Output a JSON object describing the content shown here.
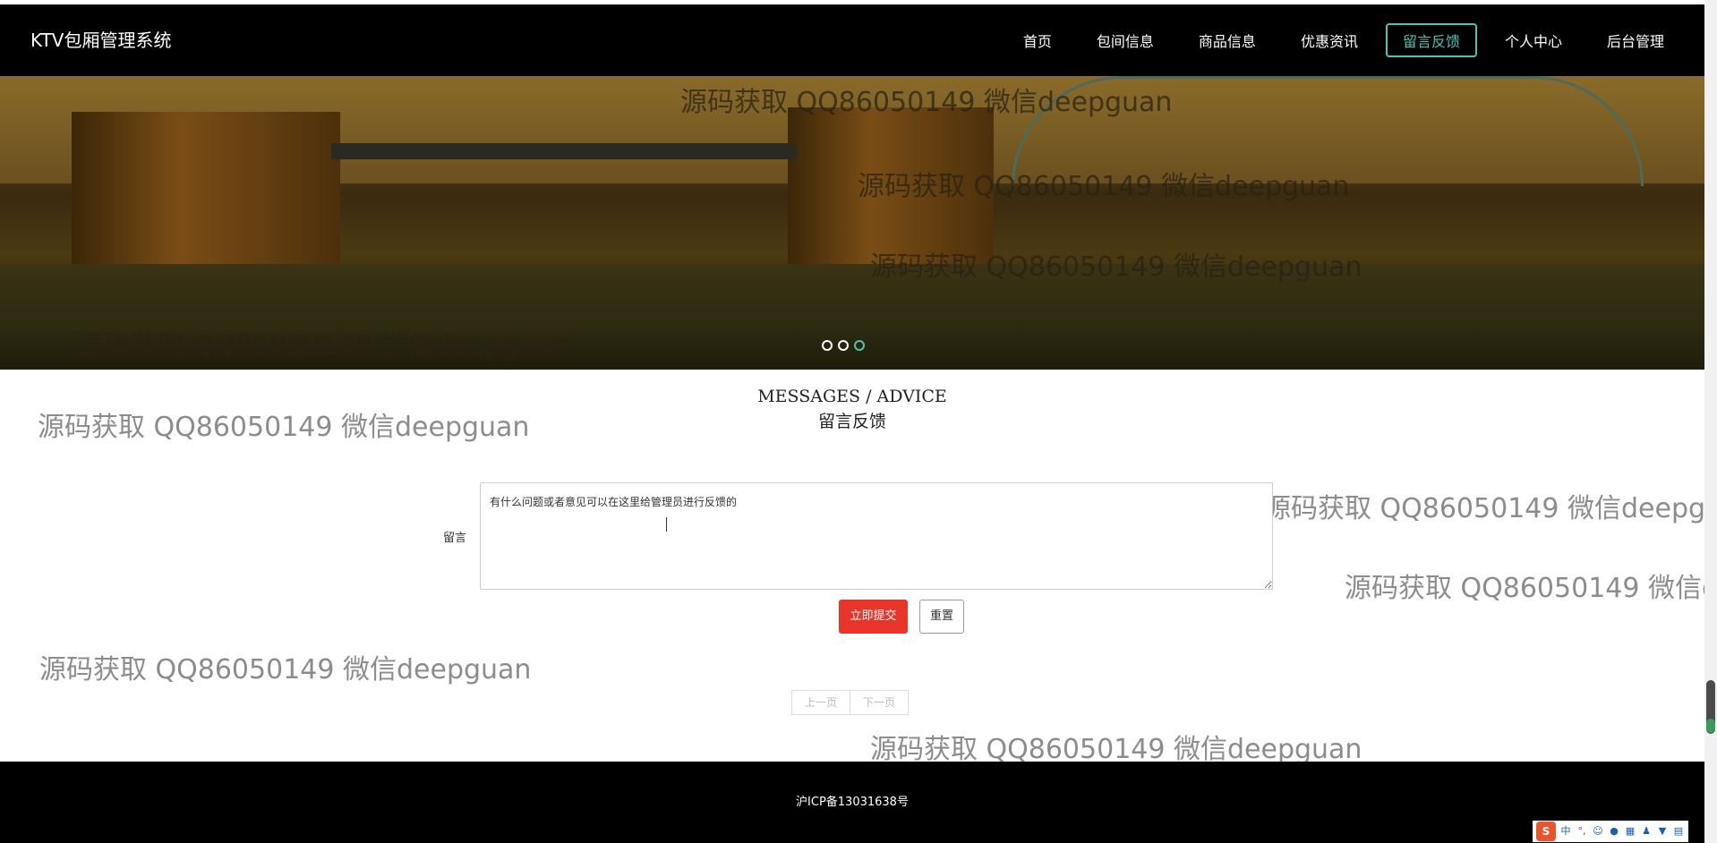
{
  "app": {
    "brand": "KTV包厢管理系统"
  },
  "nav": {
    "items": [
      {
        "label": "首页",
        "active": false
      },
      {
        "label": "包间信息",
        "active": false
      },
      {
        "label": "商品信息",
        "active": false
      },
      {
        "label": "优惠资讯",
        "active": false
      },
      {
        "label": "留言反馈",
        "active": true
      },
      {
        "label": "个人中心",
        "active": false
      },
      {
        "label": "后台管理",
        "active": false
      }
    ],
    "accent_color": "#4fc3b0"
  },
  "carousel": {
    "slide_count": 3,
    "active_index": 2
  },
  "watermark": {
    "text": "源码获取 QQ86050149 微信deepguan"
  },
  "section": {
    "title_en": "MESSAGES / ADVICE",
    "title_cn": "留言反馈"
  },
  "form": {
    "label": "留言",
    "value": "有什么问题或者意见可以在这里给管理员进行反馈的",
    "submit_label": "立即提交",
    "reset_label": "重置",
    "submit_color": "#e7352c"
  },
  "pager": {
    "prev_label": "上一页",
    "next_label": "下一页"
  },
  "footer": {
    "icp": "沪ICP备13031638号"
  },
  "ime": {
    "logo": "S",
    "mode": "中"
  }
}
